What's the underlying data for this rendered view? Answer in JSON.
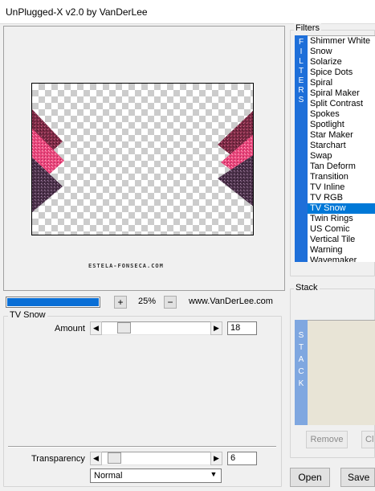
{
  "window": {
    "title": "UnPlugged-X v2.0 by VanDerLee"
  },
  "preview": {
    "credit": "ESTELA-FONSECA.COM"
  },
  "zoom": {
    "minus_label": "+",
    "plus_label": "−",
    "value": "25%",
    "progress": 1.0
  },
  "website": "www.VanDerLee.com",
  "effect": {
    "name": "TV Snow",
    "amount_label": "Amount",
    "amount_value": "18",
    "amount_fraction": 0.16,
    "transparency_label": "Transparency",
    "transparency_value": "6",
    "transparency_fraction": 0.06,
    "blend_mode": "Normal"
  },
  "filters": {
    "title": "Filters",
    "tab_letters": [
      "F",
      "I",
      "L",
      "T",
      "E",
      "R",
      "S"
    ],
    "items": [
      "Shimmer White",
      "Snow",
      "Solarize",
      "Spice Dots",
      "Spiral",
      "Spiral Maker",
      "Split Contrast",
      "Spokes",
      "Spotlight",
      "Star Maker",
      "Starchart",
      "Swap",
      "Tan Deform",
      "Transition",
      "TV Inline",
      "TV RGB",
      "TV Snow",
      "Twin Rings",
      "US Comic",
      "Vertical Tile",
      "Warning",
      "Wavemaker"
    ],
    "selected": "TV Snow"
  },
  "stack": {
    "title": "Stack",
    "tab_letters": [
      "S",
      "T",
      "A",
      "C",
      "K"
    ],
    "remove_label": "Remove",
    "clear_label": "Cl"
  },
  "buttons": {
    "open": "Open",
    "save": "Save"
  },
  "colors": {
    "accent": "#0078d7",
    "progress": "#0a6fd6",
    "pink": "#e8447a",
    "maroon": "#7a2a44",
    "plum": "#4a3049"
  }
}
